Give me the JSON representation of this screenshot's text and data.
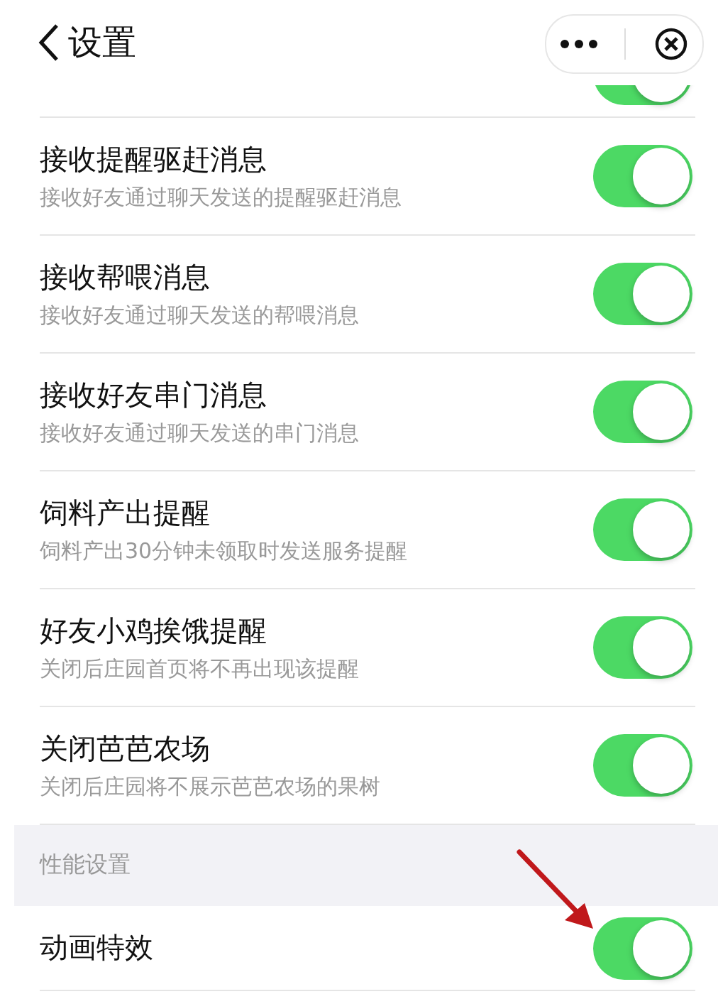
{
  "header": {
    "title": "设置"
  },
  "partial_row": {
    "on": true
  },
  "rows": [
    {
      "title": "接收提醒驱赶消息",
      "subtitle": "接收好友通过聊天发送的提醒驱赶消息",
      "on": true
    },
    {
      "title": "接收帮喂消息",
      "subtitle": "接收好友通过聊天发送的帮喂消息",
      "on": true
    },
    {
      "title": "接收好友串门消息",
      "subtitle": "接收好友通过聊天发送的串门消息",
      "on": true
    },
    {
      "title": "饲料产出提醒",
      "subtitle": "饲料产出30分钟未领取时发送服务提醒",
      "on": true
    },
    {
      "title": "好友小鸡挨饿提醒",
      "subtitle": "关闭后庄园首页将不再出现该提醒",
      "on": true
    },
    {
      "title": "关闭芭芭农场",
      "subtitle": "关闭后庄园将不展示芭芭农场的果树",
      "on": true
    }
  ],
  "section": {
    "title": "性能设置",
    "rows": [
      {
        "title": "动画特效",
        "on": true
      }
    ]
  }
}
